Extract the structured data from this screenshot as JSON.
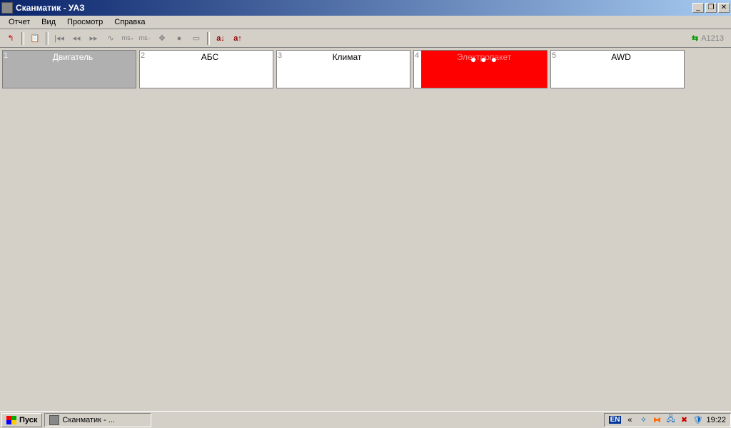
{
  "window": {
    "title": "Сканматик - УАЗ"
  },
  "menu": {
    "items": [
      "Отчет",
      "Вид",
      "Просмотр",
      "Справка"
    ]
  },
  "toolbar": {
    "back_up": "↰",
    "clipboard": "📋",
    "first": "|◂◂",
    "prev": "◂◂",
    "next": "▸▸",
    "wave": "∿",
    "ms_plus": "ms₊",
    "ms_minus": "ms₋",
    "move": "✥",
    "record": "●",
    "window": "▭",
    "sort_down": "a↓",
    "sort_up": "a↑",
    "status_code": "A1213"
  },
  "tiles": [
    {
      "num": "1",
      "label": "Двигатель",
      "state": "selected"
    },
    {
      "num": "2",
      "label": "АБС",
      "state": ""
    },
    {
      "num": "3",
      "label": "Климат",
      "state": ""
    },
    {
      "num": "4",
      "label": "Электропакет",
      "state": "error"
    },
    {
      "num": "5",
      "label": "AWD",
      "state": ""
    }
  ],
  "taskbar": {
    "start": "Пуск",
    "task1": "Сканматик - ...",
    "lang": "EN",
    "clock": "19:22"
  }
}
